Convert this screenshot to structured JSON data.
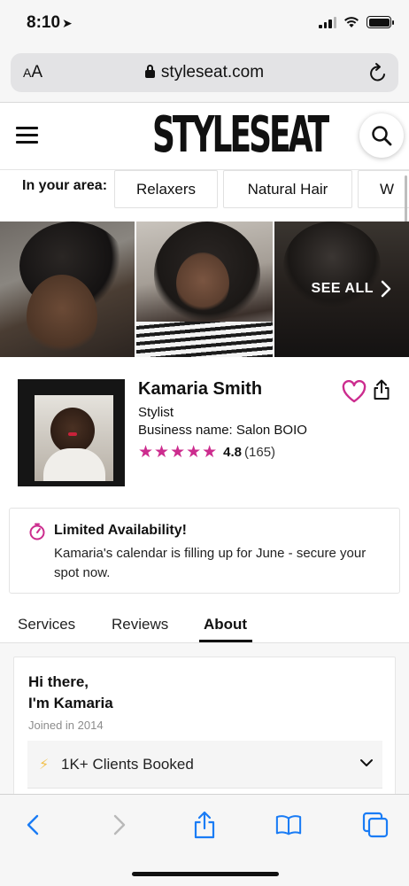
{
  "status": {
    "time": "8:10",
    "location_arrow": "location-arrow-icon"
  },
  "browser": {
    "text_size_label": "AA",
    "url": "styleseat.com"
  },
  "site": {
    "logo_text": "STYLESEAT"
  },
  "area": {
    "label": "In your area:",
    "chips": [
      "Relaxers",
      "Natural Hair",
      "W"
    ]
  },
  "gallery": {
    "see_all": "SEE ALL"
  },
  "profile": {
    "name": "Kamaria Smith",
    "role": "Stylist",
    "business": "Business name: Salon BOIO",
    "rating": 4.8,
    "rating_text": "4.8",
    "review_count": "(165)",
    "stars": "★★★★★"
  },
  "availability": {
    "title": "Limited Availability!",
    "message": "Kamaria's calendar is filling up for June - secure your spot now."
  },
  "tabs": [
    {
      "label": "Services",
      "active": false
    },
    {
      "label": "Reviews",
      "active": false
    },
    {
      "label": "About",
      "active": true
    }
  ],
  "about": {
    "greeting_line1": "Hi there,",
    "greeting_line2": "I'm Kamaria",
    "joined": "Joined in 2014",
    "stat": "1K+ Clients Booked"
  },
  "colors": {
    "brand_pink": "#cc2c8e",
    "bolt_yellow": "#f2c14e",
    "ios_blue": "#1a7cf5"
  }
}
